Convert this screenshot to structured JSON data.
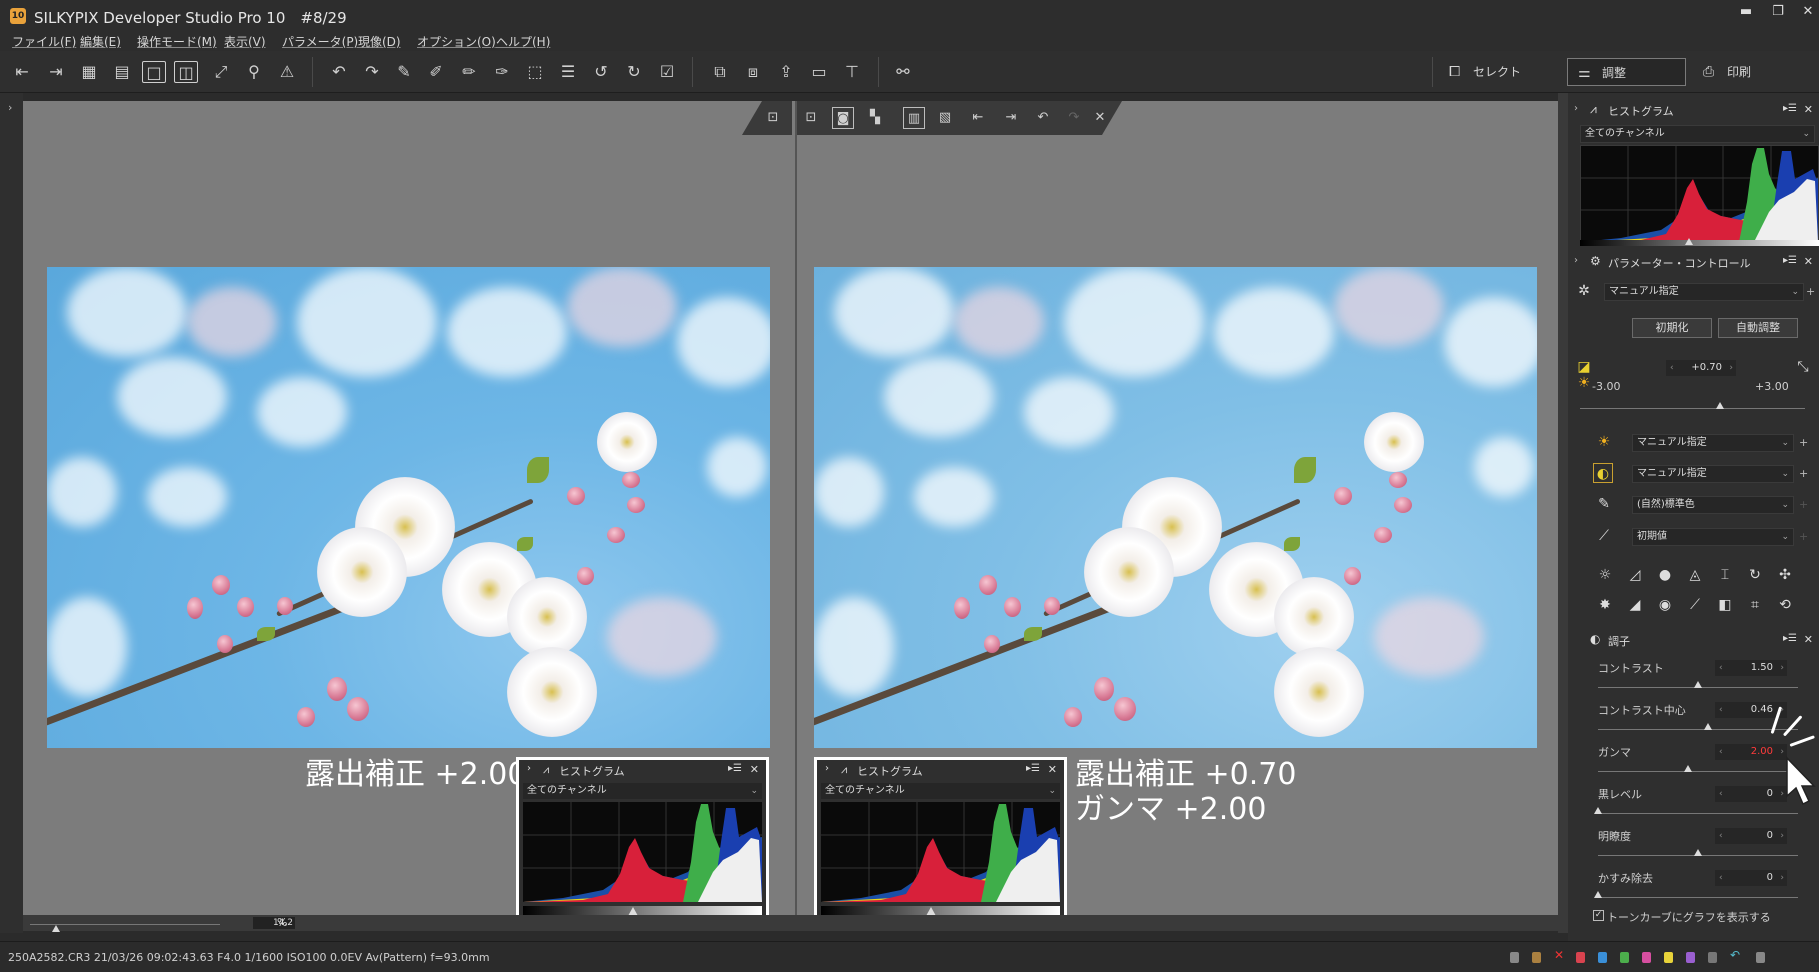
{
  "app": {
    "icon_text": "10",
    "title": "SILKYPIX Developer Studio Pro 10　#8/29"
  },
  "menu": [
    "ファイル(F)",
    "編集(E)",
    "操作モード(M)",
    "表示(V)",
    "パラメータ(P)",
    "現像(D)",
    "オプション(O)",
    "ヘルプ(H)"
  ],
  "modes": {
    "select": "セレクト",
    "adjust": "調整",
    "print": "印刷"
  },
  "overlay": {
    "left_caption": "露出補正 +2.00",
    "right_caption_line1": "露出補正 +0.70",
    "right_caption_line2": "ガンマ +2.00"
  },
  "histogram_callout": {
    "title": "ヒストグラム",
    "channel": "全てのチャンネル"
  },
  "zoom": {
    "value": "14.2",
    "unit": "%"
  },
  "status": {
    "file_info": "250A2582.CR3 21/03/26 09:02:43.63 F4.0 1/1600 ISO100 0.0EV Av(Pattern) f=93.0mm"
  },
  "sidebar": {
    "histogram": {
      "title": "ヒストグラム",
      "channel": "全てのチャンネル"
    },
    "param_control": {
      "title": "パラメーター・コントロール",
      "preset": "マニュアル指定",
      "reset_button": "初期化",
      "auto_button": "自動調整"
    },
    "exposure": {
      "value": "+0.70",
      "min": "-3.00",
      "max": "+3.00",
      "level": 0.62
    },
    "white_balance": "マニュアル指定",
    "tone": "マニュアル指定",
    "color": "(自然)標準色",
    "sharpness": "初期値",
    "tone_panel": {
      "title": "調子",
      "rows": [
        {
          "label": "コントラスト",
          "value": "1.50",
          "level": 0.5
        },
        {
          "label": "コントラスト中心",
          "value": "0.46",
          "level": 0.55
        },
        {
          "label": "ガンマ",
          "value": "2.00",
          "level": 0.45
        },
        {
          "label": "黒レベル",
          "value": "0",
          "level": 0.0
        },
        {
          "label": "明瞭度",
          "value": "0",
          "level": 0.5
        },
        {
          "label": "かすみ除去",
          "value": "0",
          "level": 0.0
        }
      ],
      "show_tone_curve": "トーンカーブにグラフを表示する"
    }
  },
  "colors": {
    "accent_red": "#ff3b3b",
    "callout_border": "#ffffff",
    "viewer_bg": "#7c7c7c"
  }
}
